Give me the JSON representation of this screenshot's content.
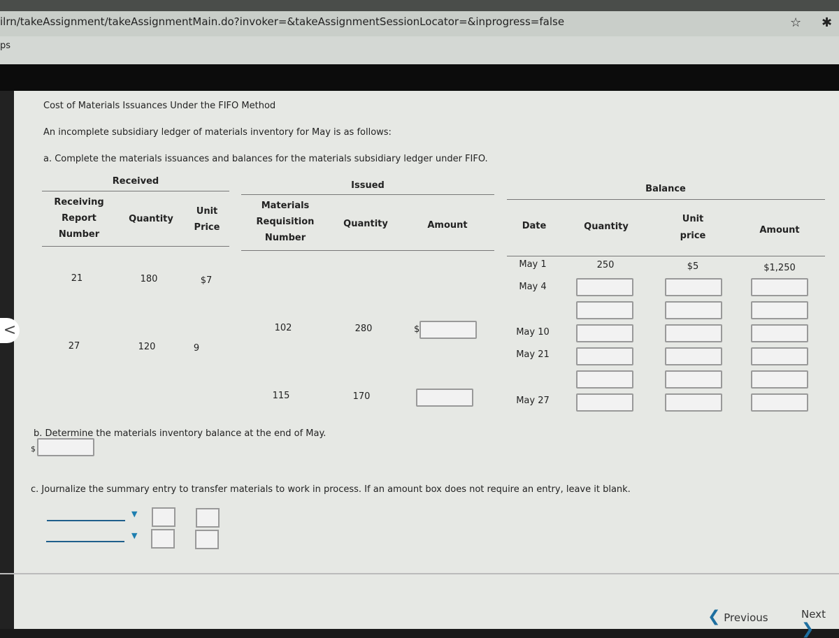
{
  "browser": {
    "url": "ilrn/takeAssignment/takeAssignmentMain.do?invoker=&takeAssignmentSessionLocator=&inprogress=false",
    "bookmarks_label": "ps",
    "star_icon": "star-icon",
    "extensions_icon": "puzzle-icon"
  },
  "problem": {
    "title": "Cost of Materials Issuances Under the FIFO Method",
    "intro": "An incomplete subsidiary ledger of materials inventory for May is as follows:",
    "part_a": "a. Complete the materials issuances and balances for the materials subsidiary ledger under FIFO.",
    "part_b": "b. Determine the materials inventory balance at the end of May.",
    "part_c": "c. Journalize the summary entry to transfer materials to work in process. If an amount box does not require an entry, leave it blank.",
    "currency": "$"
  },
  "ledger": {
    "groups": {
      "received": "Received",
      "issued": "Issued",
      "balance": "Balance"
    },
    "headers": {
      "rr1": "Receiving",
      "rr2": "Report",
      "rr3": "Number",
      "r_qty": "Quantity",
      "r_up1": "Unit",
      "r_up2": "Price",
      "mr1": "Materials",
      "mr2": "Requisition",
      "mr3": "Number",
      "i_qty": "Quantity",
      "i_amt": "Amount",
      "date": "Date",
      "b_qty": "Quantity",
      "b_up1": "Unit",
      "b_up2": "price",
      "b_amt": "Amount"
    },
    "received": [
      {
        "number": "21",
        "quantity": "180",
        "price": "$7"
      },
      {
        "number": "27",
        "quantity": "120",
        "price": "9"
      }
    ],
    "issued": [
      {
        "number": "102",
        "quantity": "280"
      },
      {
        "number": "115",
        "quantity": "170"
      }
    ],
    "dates": [
      "May 1",
      "May 4",
      "May 10",
      "May 21",
      "May 27"
    ],
    "opening_balance": {
      "quantity": "250",
      "unit_price": "$5",
      "amount": "$1,250"
    }
  },
  "nav": {
    "previous": "Previous",
    "next": "Next"
  }
}
